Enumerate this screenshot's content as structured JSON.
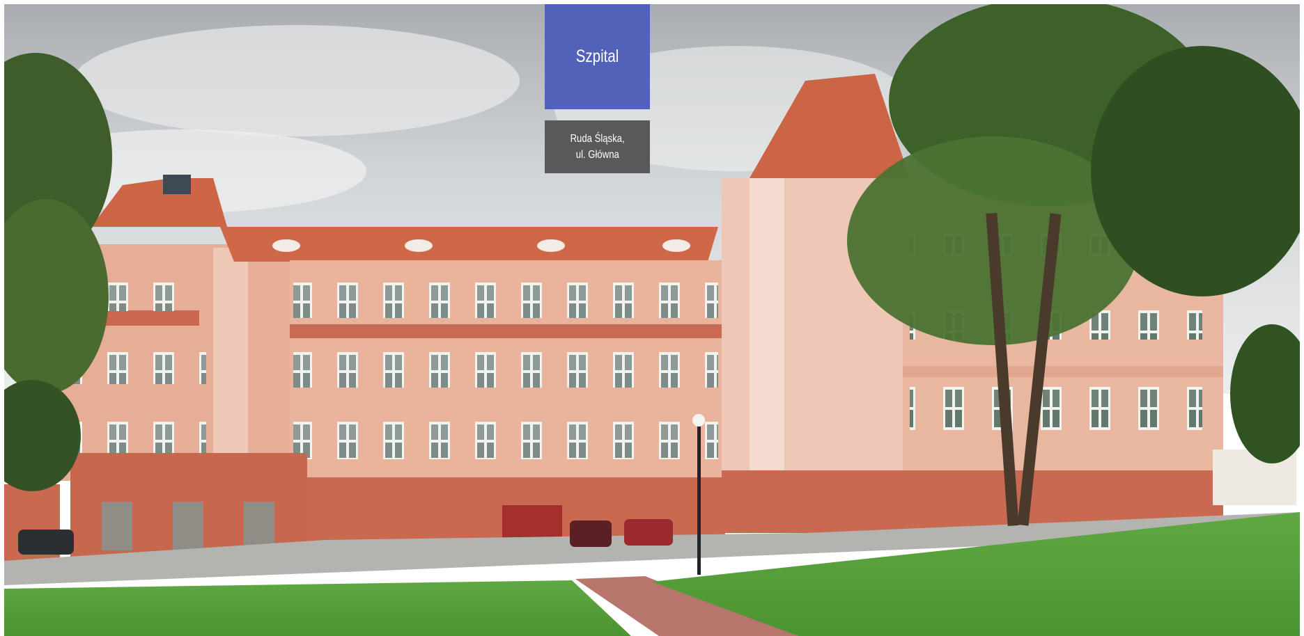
{
  "label": {
    "title": "Szpital",
    "address_line1": "Ruda Śląska,",
    "address_line2": "ul. Główna"
  },
  "colors": {
    "title_box": "#5262b9",
    "address_box": "#59595b",
    "facade": "#e9b49e",
    "roof": "#d0694b",
    "plinth": "#c96a52",
    "lawn": "#56a33a",
    "sky": "#d9dcdf"
  }
}
